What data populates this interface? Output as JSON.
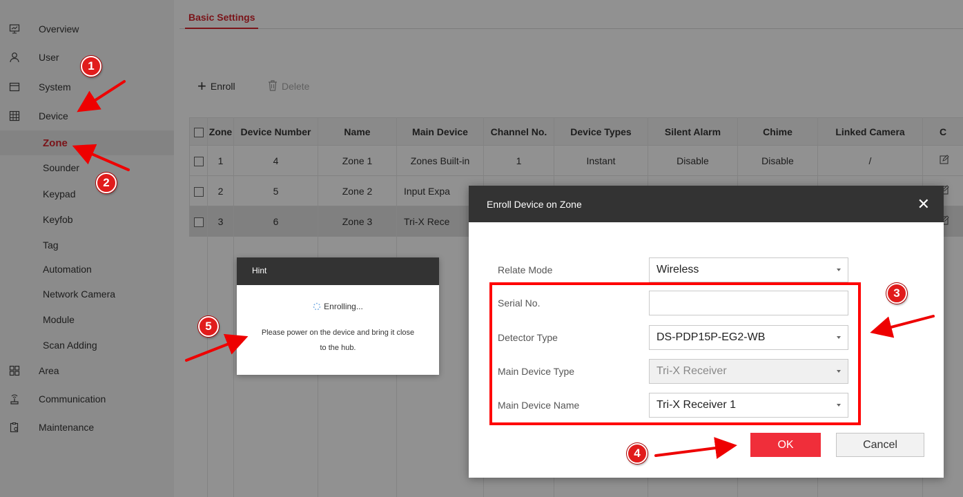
{
  "sidebar": {
    "top_items": [
      {
        "label": "Overview",
        "icon": "monitor-icon"
      },
      {
        "label": "User",
        "icon": "user-icon"
      },
      {
        "label": "System",
        "icon": "system-icon"
      },
      {
        "label": "Device",
        "icon": "device-icon"
      },
      {
        "label": "Area",
        "icon": "area-icon"
      },
      {
        "label": "Communication",
        "icon": "antenna-icon"
      },
      {
        "label": "Maintenance",
        "icon": "maintenance-icon"
      }
    ],
    "device_sub_items": [
      "Zone",
      "Sounder",
      "Keypad",
      "Keyfob",
      "Tag",
      "Automation",
      "Network Camera",
      "Module",
      "Scan Adding"
    ],
    "active_sub_item": "Zone"
  },
  "header": {
    "tab_label": "Basic Settings"
  },
  "toolbar": {
    "enroll_label": "Enroll",
    "delete_label": "Delete"
  },
  "table": {
    "columns": [
      "Zone",
      "Device Number",
      "Name",
      "Main Device",
      "Channel No.",
      "Device Types",
      "Silent Alarm",
      "Chime",
      "Linked Camera",
      "C"
    ],
    "rows": [
      [
        "1",
        "4",
        "Zone 1",
        "Zones Built-in",
        "1",
        "Instant",
        "Disable",
        "Disable",
        "/"
      ],
      [
        "2",
        "5",
        "Zone 2",
        "Input Expa",
        "",
        "",
        "",
        "",
        ""
      ],
      [
        "3",
        "6",
        "Zone 3",
        "Tri-X Rece",
        "",
        "",
        "",
        "",
        ""
      ]
    ]
  },
  "hint": {
    "title": "Hint",
    "loading": "Enrolling...",
    "message": "Please power on the device and bring it close to the hub."
  },
  "dialog": {
    "title": "Enroll Device on Zone",
    "fields": [
      {
        "label": "Relate Mode",
        "value": "Wireless",
        "type": "select",
        "disabled": false
      },
      {
        "label": "Serial No.",
        "value": "",
        "type": "text",
        "disabled": false
      },
      {
        "label": "Detector Type",
        "value": "DS-PDP15P-EG2-WB",
        "type": "select",
        "disabled": false
      },
      {
        "label": "Main Device Type",
        "value": "Tri-X Receiver",
        "type": "select",
        "disabled": true
      },
      {
        "label": "Main Device Name",
        "value": "Tri-X Receiver 1",
        "type": "select",
        "disabled": false
      }
    ],
    "ok_label": "OK",
    "cancel_label": "Cancel"
  },
  "annotations": {
    "badges": [
      "1",
      "2",
      "3",
      "4",
      "5"
    ],
    "color": "#e11c1c"
  },
  "colors": {
    "accent": "#d7242d",
    "ok_button": "#f02e3a",
    "dialog_header": "#333333"
  }
}
